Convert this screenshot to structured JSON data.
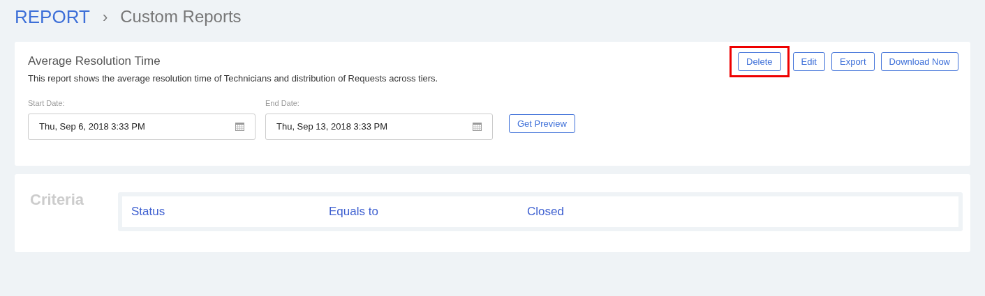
{
  "breadcrumb": {
    "root": "REPORT",
    "separator": "›",
    "current": "Custom Reports"
  },
  "report": {
    "title": "Average Resolution Time",
    "description": "This report shows the average resolution time of Technicians and distribution of Requests across tiers.",
    "actions": [
      {
        "label": "Delete",
        "highlighted": true
      },
      {
        "label": "Edit",
        "highlighted": false
      },
      {
        "label": "Export",
        "highlighted": false
      },
      {
        "label": "Download Now",
        "highlighted": false
      }
    ],
    "dates": [
      {
        "label": "Start Date:",
        "value": "Thu, Sep 6, 2018 3:33 PM"
      },
      {
        "label": "End Date:",
        "value": "Thu, Sep 13, 2018 3:33 PM"
      }
    ],
    "preview_button": "Get Preview"
  },
  "criteria": {
    "title": "Criteria",
    "rows": [
      {
        "field": "Status",
        "operator": "Equals to",
        "value": "Closed"
      }
    ]
  }
}
